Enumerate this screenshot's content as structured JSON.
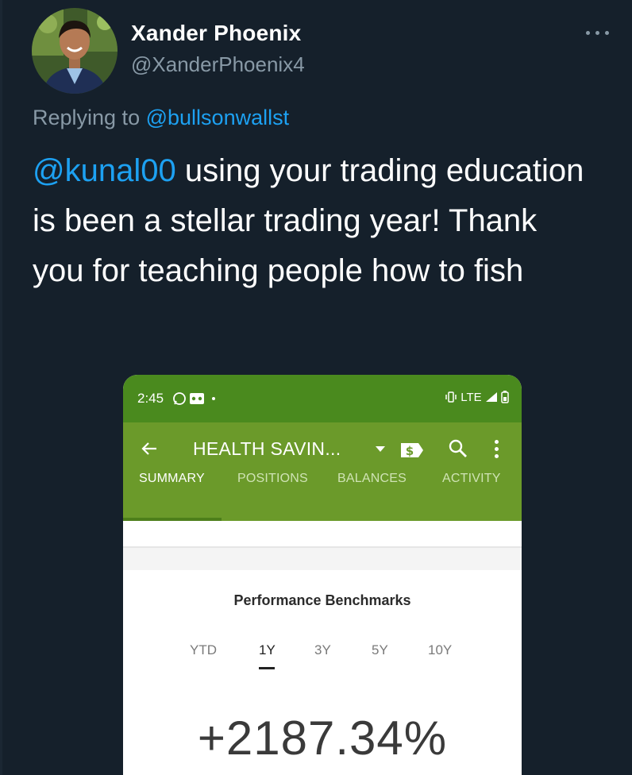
{
  "tweet": {
    "display_name": "Xander Phoenix",
    "handle": "@XanderPhoenix4",
    "replying_prefix": "Replying to",
    "replying_mention": "@bullsonwallst",
    "text_mention": "@kunal00",
    "text_body": " using your trading education is been a stellar trading year! Thank you for teaching people how to fish"
  },
  "phone": {
    "status_time": "2:45",
    "status_network": "LTE",
    "account_title": "HEALTH SAVIN...",
    "tabs": [
      {
        "label": "SUMMARY",
        "active": true
      },
      {
        "label": "POSITIONS",
        "active": false
      },
      {
        "label": "BALANCES",
        "active": false
      },
      {
        "label": "ACTIVITY",
        "active": false
      }
    ],
    "performance_title": "Performance Benchmarks",
    "ranges": [
      {
        "label": "YTD",
        "active": false
      },
      {
        "label": "1Y",
        "active": true
      },
      {
        "label": "3Y",
        "active": false
      },
      {
        "label": "5Y",
        "active": false
      },
      {
        "label": "10Y",
        "active": false
      }
    ],
    "performance_value": "+2187.34%"
  },
  "colors": {
    "background": "#15202b",
    "mention": "#1da1f2",
    "muted": "#8899a6",
    "statusbar_green": "#4a8a1e",
    "appbar_green": "#6b9a2a"
  },
  "icons": [
    "more-icon",
    "back-arrow-icon",
    "dropdown-caret-icon",
    "dollar-icon",
    "search-icon",
    "overflow-menu-icon",
    "whatsapp-icon",
    "voicemail-icon",
    "vibrate-icon",
    "signal-icon",
    "battery-icon"
  ]
}
